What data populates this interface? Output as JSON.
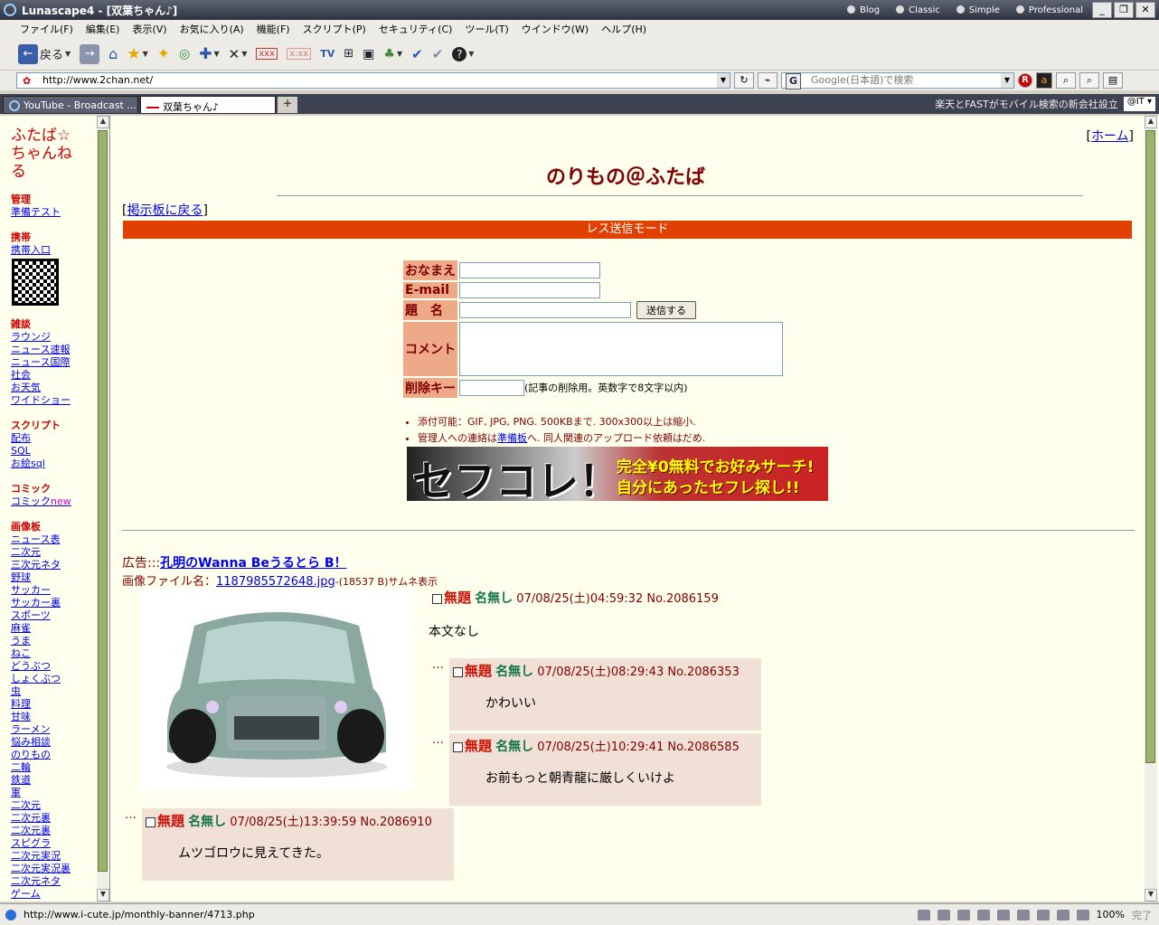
{
  "window": {
    "title": "Lunascape4 - [双葉ちゃん♪]",
    "skins": [
      "Blog",
      "Classic",
      "Simple",
      "Professional"
    ]
  },
  "menu": [
    "ファイル(F)",
    "編集(E)",
    "表示(V)",
    "お気に入り(A)",
    "機能(F)",
    "スクリプト(P)",
    "セキュリティ(C)",
    "ツール(T)",
    "ウインドウ(W)",
    "ヘルプ(H)"
  ],
  "toolbar": {
    "back_label": "戻る"
  },
  "address": {
    "url": "http://www.2chan.net/",
    "search_placeholder": "Google(日本語)で検索",
    "search_engine": "G"
  },
  "tabs": [
    {
      "label": "YouTube - Broadcast ..."
    },
    {
      "label": "双葉ちゃん♪"
    }
  ],
  "ticker": "楽天とFASTがモバイル検索の新会社設立",
  "news_source": "@IT",
  "sidebar": {
    "logo": "ふたば☆ちゃんねる",
    "groups": [
      {
        "title": "管理",
        "links": [
          "準備テスト"
        ]
      },
      {
        "title": "携帯",
        "links": [
          "携帯入口"
        ],
        "qr": true
      },
      {
        "title": "雑談",
        "links": [
          "ラウンジ",
          "ニュース速報",
          "ニュース国際",
          "社会",
          "お天気",
          "ワイドショー"
        ]
      },
      {
        "title": "スクリプト",
        "links": [
          "配布",
          "SQL",
          "お絵sql"
        ]
      },
      {
        "title": "コミック",
        "links": [
          "コミック"
        ],
        "new_badge": "new"
      },
      {
        "title": "画像板",
        "links": [
          "ニュース表",
          "二次元",
          "三次元ネタ",
          "野球",
          "サッカー",
          "サッカー裏",
          "スポーツ",
          "麻雀",
          "うま",
          "ねこ",
          "どうぶつ",
          "しょくぶつ",
          "虫",
          "料理",
          "甘味",
          "ラーメン",
          "悩み相談",
          "のりもの",
          "二輪",
          "鉄道",
          "軍",
          "二次元",
          "二次元裏",
          "二次元裏",
          "スピグラ",
          "二次元実況",
          "二次元実況裏",
          "二次元ネタ",
          "ゲーム"
        ]
      }
    ]
  },
  "board": {
    "home_label": "ホーム",
    "title": "のりもの＠ふたば",
    "back_label": "掲示板に戻る",
    "mode_label": "レス送信モード",
    "form": {
      "name_label": "おなまえ",
      "email_label": "E-mail",
      "subject_label": "題　名",
      "comment_label": "コメント",
      "delkey_label": "削除キー",
      "submit_label": "送信する",
      "delkey_hint": "(記事の削除用。英数字で8文字以内)"
    },
    "notes": [
      {
        "text": "添付可能：GIF, JPG, PNG. 500KBまで. 300x300以上は縮小."
      },
      {
        "pre": "管理人への連絡は",
        "link": "準備板",
        "post": "へ. 同人関連のアップロード依頼はだめ."
      }
    ],
    "banner": {
      "big": "セフコレ！",
      "line1": "完全¥0無料でお好みサーチ!",
      "line2": "自分にあったセフレ探し!!"
    },
    "ad": {
      "prefix": "広告:::",
      "link": "孔明のWanna Beうるとら B！"
    },
    "file": {
      "prefix": "画像ファイル名：",
      "name": "1187985572648.jpg",
      "info": "-(18537 B)サムネ表示"
    },
    "op": {
      "subject": "無題",
      "name": "名無し",
      "date": "07/08/25(土)04:59:32",
      "no": "No.2086159",
      "body": "本文なし"
    },
    "replies": [
      {
        "subject": "無題",
        "name": "名無し",
        "date": "07/08/25(土)08:29:43",
        "no": "No.2086353",
        "body": "かわいい"
      },
      {
        "subject": "無題",
        "name": "名無し",
        "date": "07/08/25(土)10:29:41",
        "no": "No.2086585",
        "body": "お前もっと朝青龍に厳しくいけよ"
      },
      {
        "subject": "無題",
        "name": "名無し",
        "date": "07/08/25(土)13:39:59",
        "no": "No.2086910",
        "body": "ムツゴロウに見えてきた。"
      }
    ],
    "dots": "…"
  },
  "status": {
    "url": "http://www.i-cute.jp/monthly-banner/4713.php",
    "zoom": "100%",
    "done": "完了"
  },
  "colors": {
    "page_bg": "#ffffee",
    "title": "#800000",
    "mode_bar": "#e04000",
    "form_label_bg": "#eeaa88",
    "reply_bg": "#f0e0d6",
    "subject": "#cc1105",
    "name": "#117743"
  }
}
